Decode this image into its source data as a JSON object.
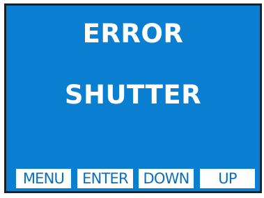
{
  "display": {
    "background_color": "#0a7fd1",
    "text_color": "#ffffff",
    "title": "ERROR",
    "detail": "SHUTTER"
  },
  "softkeys": [
    {
      "label": "MENU"
    },
    {
      "label": "ENTER"
    },
    {
      "label": "DOWN"
    },
    {
      "label": "UP"
    }
  ]
}
